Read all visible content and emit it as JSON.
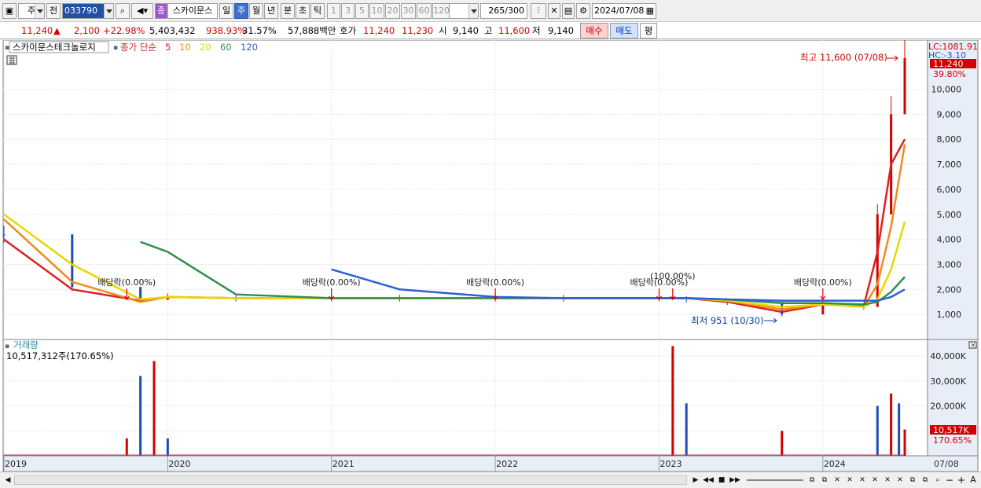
{
  "toolbar": {
    "period_type": "주",
    "prev_label": "전",
    "stock_code": "033790",
    "stock_name": "스카이문스",
    "stock_badge": "종",
    "intervals": [
      {
        "label": "일",
        "selected": false
      },
      {
        "label": "주",
        "selected": true
      },
      {
        "label": "월",
        "selected": false
      },
      {
        "label": "년",
        "selected": false
      },
      {
        "label": "분",
        "selected": false
      },
      {
        "label": "초",
        "selected": false
      },
      {
        "label": "틱",
        "selected": false
      }
    ],
    "counts": [
      "1",
      "3",
      "5",
      "10",
      "20",
      "30",
      "60",
      "120"
    ],
    "bars_shown": "265",
    "bars_total": "/300",
    "date": "2024/07/08"
  },
  "quote": {
    "price": "11,240",
    "change": "2,100",
    "change_pct": "+22.98%",
    "volume": "5,403,432",
    "volume_ratio": "938.93%",
    "turnover_pct": "31.57%",
    "amount": "57,888백만",
    "bid_label": "호가",
    "ask": "11,240",
    "bid": "11,230",
    "open_label": "시",
    "open": "9,140",
    "high_label": "고",
    "high": "11,600",
    "low_label": "저",
    "low": "9,140",
    "buy_label": "매수",
    "sell_label": "매도",
    "avg_label": "평"
  },
  "price_pane": {
    "title": "스카이문스테크놀로지",
    "ma_label": "종가 단순",
    "ma_periods": [
      {
        "label": "5",
        "color": "#e02020"
      },
      {
        "label": "10",
        "color": "#f08c1c"
      },
      {
        "label": "20",
        "color": "#e6d800"
      },
      {
        "label": "60",
        "color": "#2f8f4e"
      },
      {
        "label": "120",
        "color": "#2e5fd6"
      }
    ],
    "lc_label": "LC:1081.91",
    "hc_label": "HC:-3.10",
    "last_price_tag": "11,240",
    "last_pct_tag": "39.80%",
    "high_annotation": "최고 11,600 (07/08)",
    "low_annotation": "최저 951 (10/30)",
    "events": [
      {
        "label": "배당락(0.00%)"
      },
      {
        "label": "배당락(0.00%)"
      },
      {
        "label": "배당락(0.00%)"
      },
      {
        "label": "배당락(0.00%)"
      },
      {
        "label": "(100.00%)"
      },
      {
        "label": "배당락(0.00%)"
      }
    ]
  },
  "volume_pane": {
    "title": "거래량",
    "value_text": "10,517,312주(170.65%)",
    "last_tag": "10,517K",
    "last_pct": "170.65%"
  },
  "x_axis": {
    "labels": [
      "2019",
      "2020",
      "2021",
      "2022",
      "2023",
      "2024"
    ],
    "right_label": "07/08"
  },
  "chart_data": [
    {
      "type": "line",
      "title": "스카이문스테크놀로지",
      "x": [
        "2019-01",
        "2019-06",
        "2019-11",
        "2020-01",
        "2020-06",
        "2021-01",
        "2021-06",
        "2022-01",
        "2022-06",
        "2023-01",
        "2023-03",
        "2023-06",
        "2023-10",
        "2024-01",
        "2024-04",
        "2024-05",
        "2024-06",
        "2024-07"
      ],
      "series": [
        {
          "name": "종가",
          "values": [
            4200,
            2100,
            1600,
            1700,
            1650,
            1650,
            1650,
            1650,
            1650,
            1650,
            1600,
            1500,
            1000,
            1400,
            1300,
            5000,
            9000,
            11240
          ]
        },
        {
          "name": "5",
          "values": [
            4000,
            2000,
            1550,
            1700,
            1650,
            1650,
            1650,
            1650,
            1650,
            1650,
            1650,
            1500,
            1100,
            1400,
            1350,
            3500,
            7000,
            8000
          ]
        },
        {
          "name": "10",
          "values": [
            4800,
            2300,
            1500,
            1700,
            1650,
            1650,
            1650,
            1650,
            1650,
            1650,
            1650,
            1550,
            1200,
            1400,
            1300,
            2200,
            4500,
            7800
          ]
        },
        {
          "name": "20",
          "values": [
            5000,
            3000,
            1600,
            1700,
            1650,
            1650,
            1650,
            1650,
            1650,
            1650,
            1650,
            1550,
            1300,
            1400,
            1300,
            1600,
            2800,
            4700
          ]
        },
        {
          "name": "60",
          "values": [
            null,
            null,
            3900,
            3500,
            1800,
            1650,
            1650,
            1650,
            1650,
            1650,
            1650,
            1600,
            1450,
            1450,
            1400,
            1500,
            1900,
            2500
          ]
        },
        {
          "name": "120",
          "values": [
            null,
            null,
            null,
            null,
            null,
            2800,
            2000,
            1700,
            1650,
            1650,
            1650,
            1600,
            1550,
            1550,
            1550,
            1550,
            1700,
            2000
          ]
        }
      ],
      "ylim": [
        0,
        11900
      ],
      "y_ticks": [
        "1,000",
        "2,000",
        "3,000",
        "4,000",
        "5,000",
        "6,000",
        "7,000",
        "8,000",
        "9,000",
        "10,000"
      ]
    },
    {
      "type": "bar",
      "title": "거래량",
      "x": [
        "2019-10",
        "2019-11",
        "2019-12",
        "2020-01",
        "2023-02",
        "2023-03",
        "2023-10",
        "2024-05",
        "2024-06",
        "2024-06b",
        "2024-07"
      ],
      "values": [
        7000,
        32000,
        38000,
        7000,
        44000,
        21000,
        10000,
        20000,
        25000,
        21000,
        10517
      ],
      "ylim": [
        0,
        46000
      ],
      "y_ticks": [
        "10,000K",
        "20,000K",
        "30,000K",
        "40,000K"
      ]
    }
  ]
}
